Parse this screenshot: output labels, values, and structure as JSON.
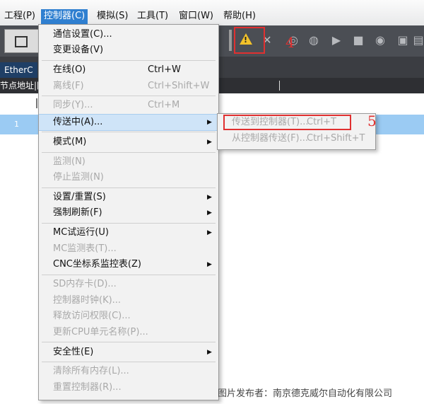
{
  "menubar": {
    "items": [
      "工程(P)",
      "控制器(C)",
      "模拟(S)",
      "工具(T)",
      "窗口(W)",
      "帮助(H)"
    ],
    "active_index": 1
  },
  "tab": {
    "label": "EtherC"
  },
  "column_header": {
    "label": "节点地址|网"
  },
  "row": {
    "number": "1"
  },
  "controller_menu": {
    "items": [
      {
        "label": "通信设置(C)...",
        "shortcut": "",
        "enabled": true,
        "submenu": false
      },
      {
        "label": "变更设备(V)",
        "shortcut": "",
        "enabled": true,
        "submenu": false
      },
      {
        "label": "在线(O)",
        "shortcut": "Ctrl+W",
        "enabled": true,
        "submenu": false
      },
      {
        "label": "离线(F)",
        "shortcut": "Ctrl+Shift+W",
        "enabled": false,
        "submenu": false
      },
      {
        "label": "同步(Y)...",
        "shortcut": "Ctrl+M",
        "enabled": false,
        "submenu": false
      },
      {
        "label": "传送中(A)...",
        "shortcut": "",
        "enabled": true,
        "submenu": true,
        "highlighted": true
      },
      {
        "label": "模式(M)",
        "shortcut": "",
        "enabled": true,
        "submenu": true
      },
      {
        "label": "监测(N)",
        "shortcut": "",
        "enabled": false,
        "submenu": false
      },
      {
        "label": "停止监测(N)",
        "shortcut": "",
        "enabled": false,
        "submenu": false
      },
      {
        "label": "设置/重置(S)",
        "shortcut": "",
        "enabled": true,
        "submenu": true
      },
      {
        "label": "强制刷新(F)",
        "shortcut": "",
        "enabled": true,
        "submenu": true
      },
      {
        "label": "MC试运行(U)",
        "shortcut": "",
        "enabled": true,
        "submenu": true
      },
      {
        "label": "MC监测表(T)...",
        "shortcut": "",
        "enabled": false,
        "submenu": false
      },
      {
        "label": "CNC坐标系监控表(Z)",
        "shortcut": "",
        "enabled": true,
        "submenu": true
      },
      {
        "label": "SD内存卡(D)...",
        "shortcut": "",
        "enabled": false,
        "submenu": false
      },
      {
        "label": "控制器时钟(K)...",
        "shortcut": "",
        "enabled": false,
        "submenu": false
      },
      {
        "label": "释放访问权限(C)...",
        "shortcut": "",
        "enabled": false,
        "submenu": false
      },
      {
        "label": "更新CPU单元名称(P)...",
        "shortcut": "",
        "enabled": false,
        "submenu": false
      },
      {
        "label": "安全性(E)",
        "shortcut": "",
        "enabled": true,
        "submenu": true
      },
      {
        "label": "清除所有内存(L)...",
        "shortcut": "",
        "enabled": false,
        "submenu": false
      },
      {
        "label": "重置控制器(R)...",
        "shortcut": "",
        "enabled": false,
        "submenu": false
      }
    ]
  },
  "transfer_submenu": {
    "items": [
      {
        "label": "传送到控制器(T)...",
        "shortcut": "Ctrl+T",
        "enabled": false
      },
      {
        "label": "从控制器传送(F)...",
        "shortcut": "Ctrl+Shift+T",
        "enabled": false
      }
    ]
  },
  "annotations": {
    "toolbar_marker": "4",
    "submenu_marker": "5"
  },
  "watermark": "图片发布者：南京德克威尔自动化有限公司",
  "colors": {
    "accent": "#2f7fd0",
    "highlight": "#cfe4f8",
    "annotation": "#e03030",
    "toolbar": "#4b4e54"
  }
}
